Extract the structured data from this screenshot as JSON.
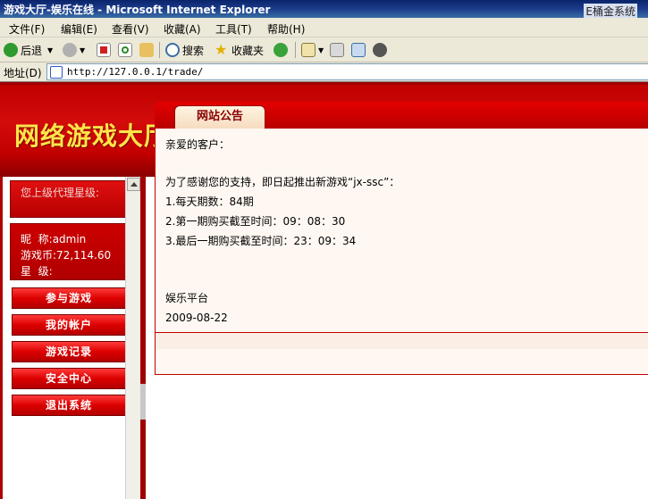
{
  "window": {
    "title": "游戏大厅-娱乐在线 - Microsoft Internet Explorer",
    "right_label": "E桶金系统"
  },
  "menu": [
    "文件(F)",
    "编辑(E)",
    "查看(V)",
    "收藏(A)",
    "工具(T)",
    "帮助(H)"
  ],
  "toolbar": {
    "back_label": "后退",
    "search_label": "搜索",
    "favorites_label": "收藏夹"
  },
  "address": {
    "label": "地址(D)",
    "url": "http://127.0.0.1/trade/"
  },
  "banner": {
    "logo": "网络游戏大厅"
  },
  "sidebar": {
    "agent_rank": "您上级代理星级:",
    "nickname_label": "昵  称:",
    "nickname": "admin",
    "coins_label": "游戏币:",
    "coins": "72,114.60",
    "stars_label": "星  级:",
    "nav": [
      "参与游戏",
      "我的帐户",
      "游戏记录",
      "安全中心",
      "退出系统"
    ]
  },
  "notice": {
    "tab_title": "网站公告",
    "lines": [
      "亲爱的客户：",
      "为了感谢您的支持，即日起推出新游戏“jx-ssc”：",
      "1.每天期数：84期",
      "2.第一期购买截至时间：09：08：30",
      "3.最后一期购买截至时间：23：09：34",
      "娱乐平台",
      "2009-08-22"
    ]
  },
  "colors": {
    "brand_red": "#c00000",
    "logo_yellow": "#ffe44a",
    "panel_bg": "#fff8f2"
  }
}
